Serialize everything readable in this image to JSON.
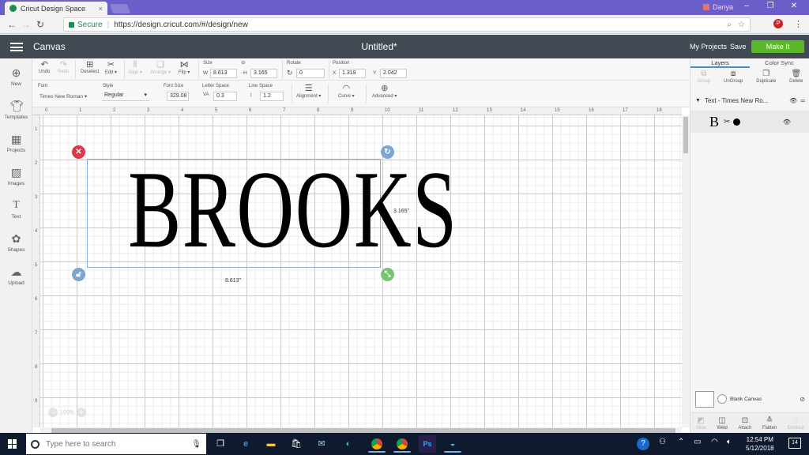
{
  "browser": {
    "tab_title": "Cricut Design Space",
    "tab_close": "×",
    "profile_name": "Danya",
    "secure_label": "Secure",
    "url": "https://design.cricut.com/#/design/new",
    "window_controls": [
      "–",
      "❐",
      "✕"
    ]
  },
  "header": {
    "app_title": "Canvas",
    "doc_title": "Untitled*",
    "my_projects": "My Projects",
    "save": "Save",
    "make_it": "Make It"
  },
  "sidebar": {
    "items": [
      {
        "label": "New",
        "icon": "plus-icon"
      },
      {
        "label": "Templates",
        "icon": "shirt-icon"
      },
      {
        "label": "Projects",
        "icon": "grid-icon"
      },
      {
        "label": "Images",
        "icon": "image-icon"
      },
      {
        "label": "Text",
        "icon": "text-icon"
      },
      {
        "label": "Shapes",
        "icon": "shapes-icon"
      },
      {
        "label": "Upload",
        "icon": "upload-icon"
      }
    ]
  },
  "toolbar1": {
    "undo": "Undo",
    "redo": "Redo",
    "deselect": "Deselect",
    "edit": "Edit ▾",
    "align": "Align ▾",
    "arrange": "Arrange ▾",
    "flip": "Flip ▾",
    "size_label": "Size",
    "w_label": "W",
    "w_value": "8.613",
    "h_label": "H",
    "h_value": "3.165",
    "rotate_label": "Rotate",
    "rotate_value": "0",
    "position_label": "Position",
    "x_label": "X",
    "x_value": "1.319",
    "y_label": "Y",
    "y_value": "2.042"
  },
  "toolbar2": {
    "font_label": "Font",
    "font_value": "Times New Roman ▾",
    "style_label": "Style",
    "style_value": "Regular",
    "font_size_label": "Font Size",
    "font_size_value": "329.08",
    "letter_space_label": "Letter Space",
    "letter_space_value": "0.3",
    "line_space_label": "Line Space",
    "line_space_value": "1.2",
    "alignment": "Alignment ▾",
    "curve": "Curve ▾",
    "advanced": "Advanced ▾"
  },
  "ruler": {
    "top": [
      "0",
      "1",
      "2",
      "3",
      "4",
      "5",
      "6",
      "7",
      "8",
      "9",
      "10",
      "11",
      "12",
      "13",
      "14",
      "15",
      "16",
      "17",
      "18"
    ],
    "left": [
      "1",
      "2",
      "3",
      "4",
      "5",
      "6",
      "7",
      "8",
      "9"
    ]
  },
  "canvas": {
    "text": "BROOKS",
    "height_dim": "3.165\"",
    "width_dim": "8.613\"",
    "zoom_value": "100%",
    "zoom_minus": "−",
    "zoom_plus": "+"
  },
  "rpanel": {
    "tab_layers": "Layers",
    "tab_color_sync": "Color Sync",
    "group": "Group",
    "ungroup": "UnGroup",
    "duplicate": "Duplicate",
    "delete": "Delete",
    "layer_name": "Text - Times New Ro...",
    "layer_glyph": "B",
    "blank_canvas": "Blank Canvas",
    "slice": "Slice",
    "weld": "Weld",
    "attach": "Attach",
    "flatten": "Flatten",
    "contour": "Contour"
  },
  "taskbar": {
    "search_placeholder": "Type here to search",
    "time": "12:54 PM",
    "date": "5/12/2018",
    "notif_count": "14"
  },
  "colors": {
    "make_it": "#5cb82b",
    "header_bg": "#414a52",
    "close_handle": "#d9394a",
    "rotate_handle": "#7aa6d6",
    "size_handle": "#77c370"
  }
}
